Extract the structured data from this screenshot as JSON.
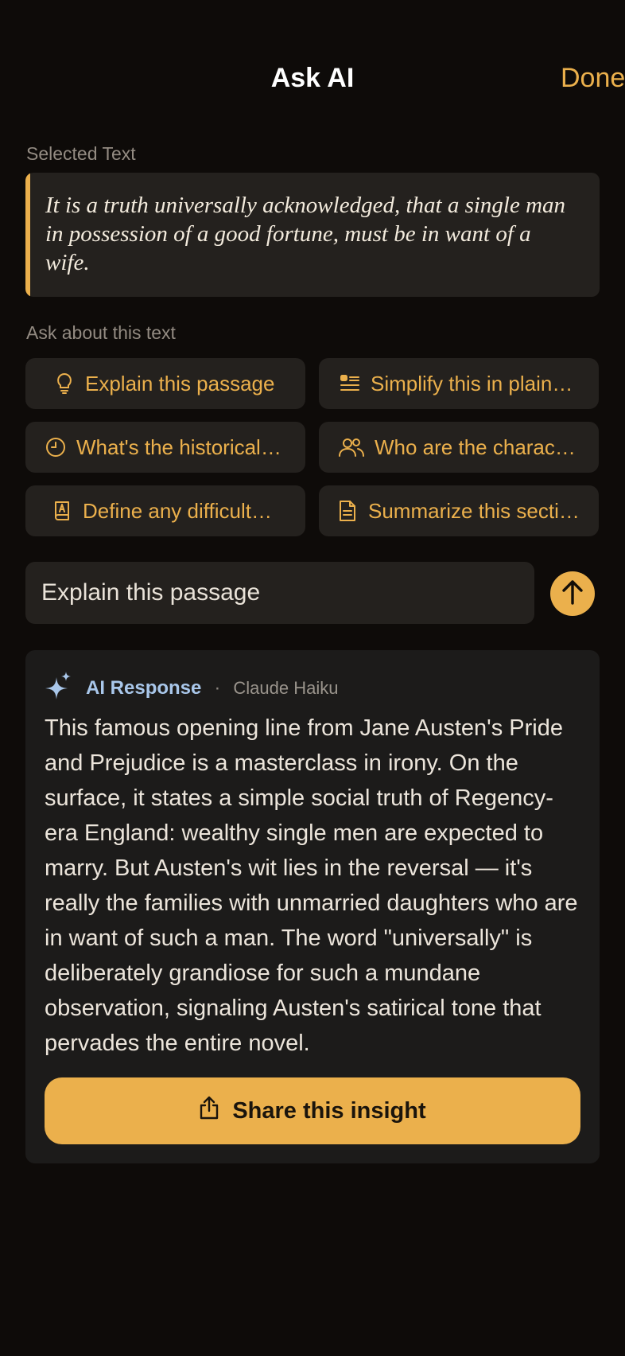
{
  "header": {
    "title": "Ask AI",
    "done_label": "Done"
  },
  "selected": {
    "label": "Selected Text",
    "text": "It is a truth universally acknowledged, that a single man in possession of a good fortune, must be in want of a wife."
  },
  "ask": {
    "label": "Ask about this text",
    "chips": [
      {
        "label": "Explain this passage",
        "icon": "lightbulb-icon"
      },
      {
        "label": "Simplify this in plain…",
        "icon": "text-lines-icon"
      },
      {
        "label": "What's the historical…",
        "icon": "clock-icon"
      },
      {
        "label": "Who are the charac…",
        "icon": "people-icon"
      },
      {
        "label": "Define any difficult…",
        "icon": "dictionary-icon"
      },
      {
        "label": "Summarize this secti…",
        "icon": "document-icon"
      }
    ]
  },
  "input": {
    "value": "Explain this passage"
  },
  "response": {
    "title": "AI Response",
    "separator": "·",
    "model": "Claude Haiku",
    "body": "This famous opening line from Jane Austen's Pride and Prejudice is a masterclass in irony. On the surface, it states a simple social truth of Regency-era England: wealthy single men are expected to marry. But Austen's wit lies in the reversal — it's really the families with unmarried daughters who are in want of such a man. The word \"universally\" is deliberately grandiose for such a mundane observation, signaling Austen's satirical tone that pervades the entire novel.",
    "share_label": "Share this insight"
  },
  "colors": {
    "background": "#0e0b09",
    "accent": "#ebb04c",
    "card": "#24211e",
    "response_title": "#a9c7ea"
  }
}
